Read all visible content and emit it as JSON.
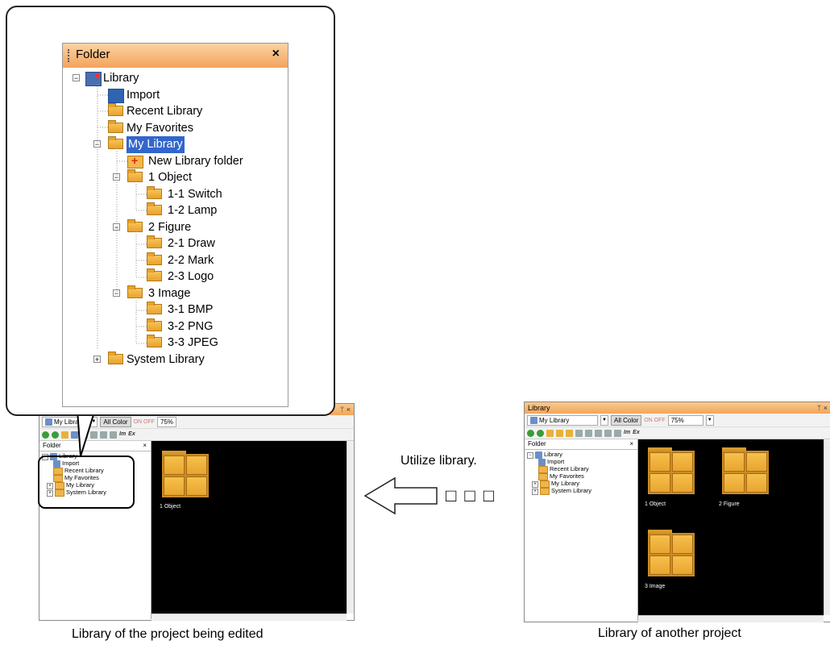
{
  "zoom_panel": {
    "title": "Folder",
    "close": "×",
    "items": [
      {
        "label": "Library"
      },
      {
        "label": "Import"
      },
      {
        "label": "Recent Library"
      },
      {
        "label": "My Favorites"
      },
      {
        "label": "My Library"
      },
      {
        "label": "New Library folder"
      },
      {
        "label": "1 Object"
      },
      {
        "label": "1-1 Switch"
      },
      {
        "label": "1-2 Lamp"
      },
      {
        "label": "2 Figure"
      },
      {
        "label": "2-1 Draw"
      },
      {
        "label": "2-2 Mark"
      },
      {
        "label": "2-3 Logo"
      },
      {
        "label": "3 Image"
      },
      {
        "label": "3-1 BMP"
      },
      {
        "label": "3-2 PNG"
      },
      {
        "label": "3-3 JPEG"
      },
      {
        "label": "System Library"
      }
    ],
    "tree_toggle_minus": "⊟",
    "tree_toggle_plus": "⊞"
  },
  "left_window": {
    "library_select": "My Library",
    "color_button": "All Color",
    "on_off": "ON OFF",
    "zoom": "75%",
    "pin": "ᛘ ×",
    "folder_pane_title": "Folder",
    "folder_pane_close": "×",
    "tree": [
      "Library",
      "Import",
      "Recent Library",
      "My Favorites",
      "My Library",
      "System Library"
    ],
    "folders": [
      "1 Object"
    ]
  },
  "right_window": {
    "title": "Library",
    "library_select": "My Library",
    "color_button": "All Color",
    "on_off": "ON OFF",
    "zoom": "75%",
    "pin": "ᛘ ×",
    "folder_pane_title": "Folder",
    "folder_pane_close": "×",
    "tree": [
      "Library",
      "Import",
      "Recent Library",
      "My Favorites",
      "My Library",
      "System Library"
    ],
    "folders": [
      "1 Object",
      "2 Figure",
      "3 Image"
    ]
  },
  "arrow": {
    "label": "Utilize library.",
    "boxes": "□ □ □"
  },
  "captions": {
    "left": "Library of the project being edited",
    "right": "Library of another project"
  }
}
